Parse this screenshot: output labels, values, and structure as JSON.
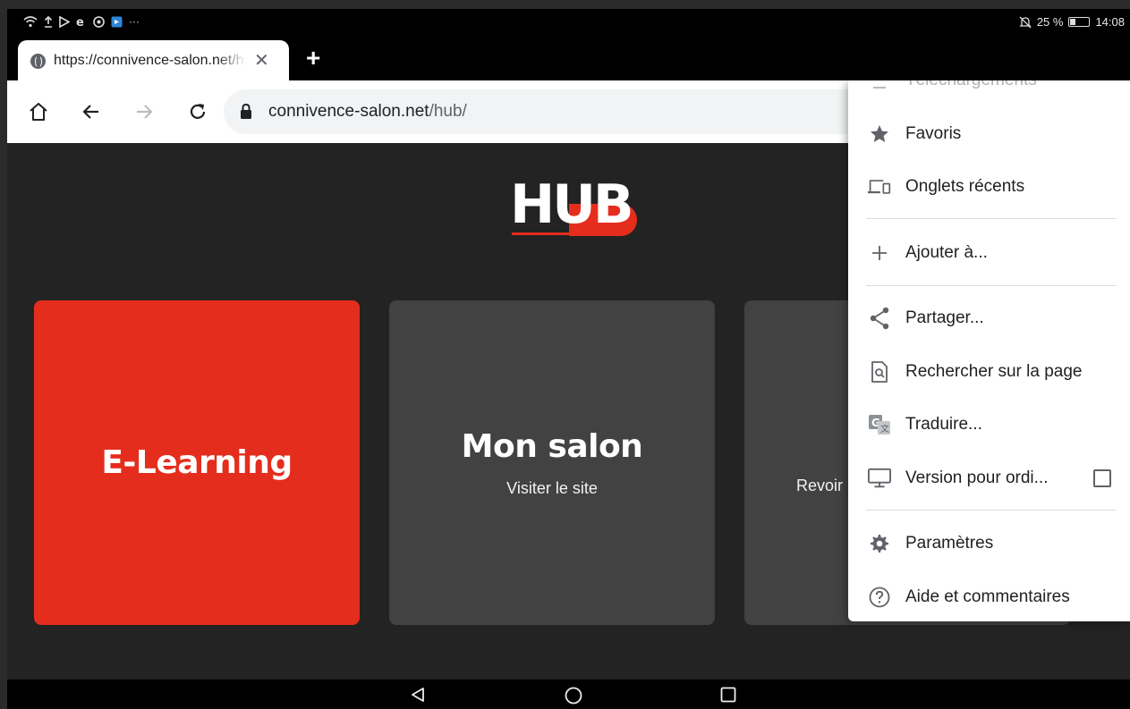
{
  "status_bar": {
    "left_more": "···",
    "battery": "25 %",
    "time": "14:08"
  },
  "tab": {
    "title": "https://connivence-salon.net/hub/",
    "close": "✕",
    "new_tab": "+"
  },
  "omnibox": {
    "domain": "connivence-salon.net",
    "path": "/hub/"
  },
  "logo": {
    "text": "HUB"
  },
  "cards": [
    {
      "title": "E-Learning",
      "subtitle": ""
    },
    {
      "title": "Mon salon",
      "subtitle": "Visiter le site"
    },
    {
      "title": "",
      "subtitle": "Revoir"
    }
  ],
  "menu": {
    "items": [
      {
        "label": "Téléchargements",
        "icon": "download-icon"
      },
      {
        "label": "Favoris",
        "icon": "star-icon"
      },
      {
        "label": "Onglets récents",
        "icon": "devices-icon"
      },
      {
        "label": "Ajouter à...",
        "icon": "plus-icon"
      },
      {
        "label": "Partager...",
        "icon": "share-icon"
      },
      {
        "label": "Rechercher sur la page",
        "icon": "find-in-page-icon"
      },
      {
        "label": "Traduire...",
        "icon": "translate-icon"
      },
      {
        "label": "Version pour ordi...",
        "icon": "desktop-icon",
        "checked": false
      },
      {
        "label": "Paramètres",
        "icon": "gear-icon"
      },
      {
        "label": "Aide et commentaires",
        "icon": "help-icon"
      }
    ]
  },
  "colors": {
    "accent_red": "#e52d1d",
    "card_gray": "#424242",
    "page_bg": "#232323"
  }
}
